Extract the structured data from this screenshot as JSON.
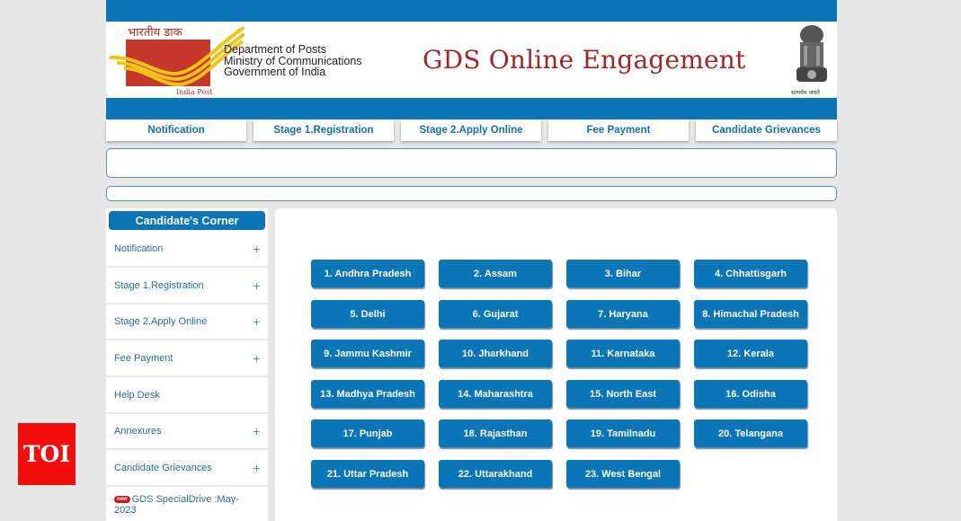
{
  "header": {
    "logo_hindi": "भारतीय डाक",
    "logo_caption": "India Post",
    "dept_lines": [
      "Department of Posts",
      "Ministry of Communications",
      "Government of India"
    ],
    "title": "GDS Online Engagement",
    "emblem_motto": "सत्यमेव जयते"
  },
  "nav": [
    {
      "label": "Notification"
    },
    {
      "label": "Stage 1.Registration"
    },
    {
      "label": "Stage 2.Apply Online"
    },
    {
      "label": "Fee Payment"
    },
    {
      "label": "Candidate Grievances"
    }
  ],
  "sidebar": {
    "title": "Candidate's Corner",
    "items": [
      {
        "label": "Notification",
        "expand": "+"
      },
      {
        "label": "Stage 1.Registration",
        "expand": "+"
      },
      {
        "label": "Stage 2.Apply Online",
        "expand": "+"
      },
      {
        "label": "Fee Payment",
        "expand": "+"
      },
      {
        "label": "Help Desk",
        "expand": ""
      },
      {
        "label": "Annexures",
        "expand": "+"
      },
      {
        "label": "Candidate Grievances",
        "expand": "+"
      },
      {
        "label": "GDS SpecialDrive :May-2023",
        "expand": "",
        "badge": "new"
      }
    ]
  },
  "states": [
    "1. Andhra Pradesh",
    "2. Assam",
    "3. Bihar",
    "4. Chhattisgarh",
    "5. Delhi",
    "6. Gujarat",
    "7. Haryana",
    "8. Himachal Pradesh",
    "9. Jammu Kashmir",
    "10. Jharkhand",
    "11. Karnataka",
    "12. Kerala",
    "13. Madhya Pradesh",
    "14. Maharashtra",
    "15. North East",
    "16. Odisha",
    "17. Punjab",
    "18. Rajasthan",
    "19. Tamilnadu",
    "20. Telangana",
    "21. Uttar Pradesh",
    "22. Uttarakhand",
    "23. West Bengal"
  ],
  "watermark": "TOI",
  "colors": {
    "brand_blue": "#0a76b8",
    "title_red": "#a82424",
    "toi_red": "#f20c0c"
  }
}
